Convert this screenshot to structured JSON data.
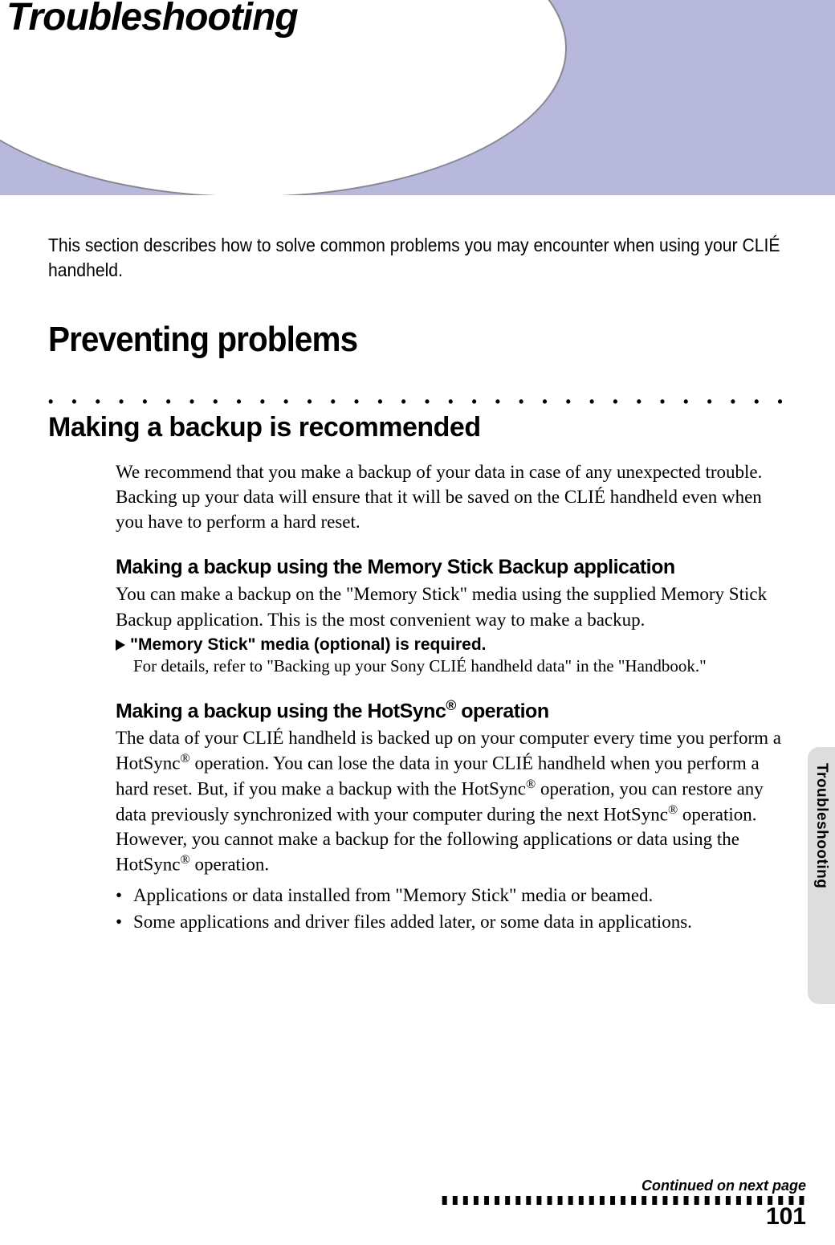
{
  "chapter_title": "Troubleshooting",
  "intro": "This section describes how to solve common problems you may encounter when using your CLIÉ handheld.",
  "h1": "Preventing problems",
  "dots": "• • • • • • • • • • • • • • • • • • • • • • • • • • • • • • • • • • • • • • • • • • • • • • • • • • • • • • •",
  "h2": "Making a backup is recommended",
  "p1": "We recommend that you make a backup of your data in case of any unexpected trouble. Backing up your data will ensure that it will be saved on the CLIÉ handheld even when you have to perform a hard reset.",
  "h3a": "Making a backup using the Memory Stick Backup application",
  "p2": "You can make a backup on the \"Memory Stick\" media using the supplied Memory Stick Backup application. This is the most convenient way to make a backup.",
  "note_bold": "\"Memory Stick\" media (optional) is required.",
  "note_sub": "For details, refer to \"Backing up your Sony CLIÉ handheld data\" in the \"Handbook.\"",
  "h3b_pre": "Making a backup using the HotSync",
  "h3b_post": " operation",
  "reg": "®",
  "p3a": "The data of your CLIÉ handheld is backed up on your computer every time you perform a HotSync",
  "p3b": " operation. You can lose the data in your CLIÉ handheld when you perform a hard reset. But, if you make a backup with the HotSync",
  "p3c": " operation, you can restore any data previously synchronized with your computer during the next HotSync",
  "p3d": " operation.",
  "p4a": "However, you cannot make a backup for the following applications or data using the HotSync",
  "p4b": " operation.",
  "bullet1": "Applications or data installed from \"Memory Stick\" media or beamed.",
  "bullet2": "Some applications and driver files added later, or some data in applications.",
  "side_label": "Troubleshooting",
  "continued": "Continued on next page",
  "arrows": "❚❚❚❚❚❚❚❚❚❚❚❚❚❚❚❚❚❚❚❚❚❚❚❚❚❚❚❚❚❚❚❚❚❚❚",
  "page_number": "101"
}
